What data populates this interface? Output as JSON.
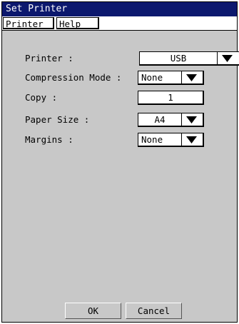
{
  "window": {
    "title": "Set Printer"
  },
  "menu": {
    "printer": "Printer",
    "help": "Help"
  },
  "form": {
    "printer": {
      "label": "Printer :",
      "value": "USB"
    },
    "compression": {
      "label": "Compression Mode :",
      "value": "None"
    },
    "copy": {
      "label": "Copy :",
      "value": "1"
    },
    "paper": {
      "label": "Paper Size :",
      "value": "A4"
    },
    "margins": {
      "label": "Margins :",
      "value": "None"
    }
  },
  "buttons": {
    "ok": "OK",
    "cancel": "Cancel"
  },
  "colors": {
    "titlebar": "#0c186e",
    "dialog_bg": "#c8c8c8"
  },
  "icons": {
    "dropdown": "triangle-down-icon"
  }
}
